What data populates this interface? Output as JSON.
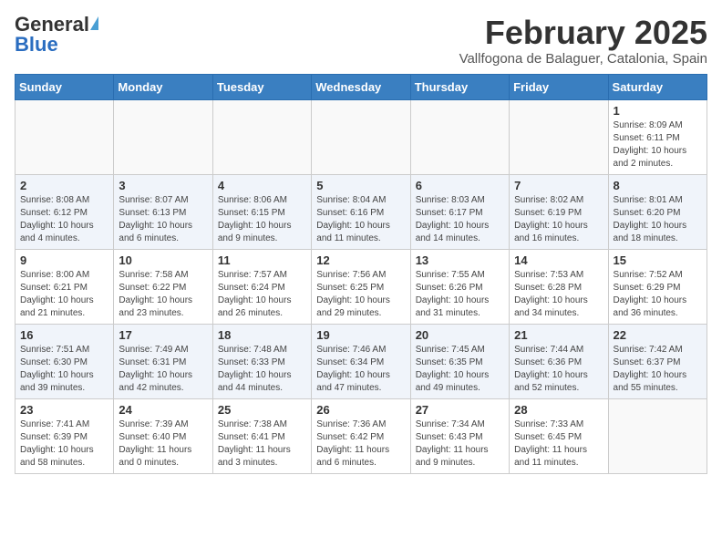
{
  "header": {
    "logo_general": "General",
    "logo_blue": "Blue",
    "month_title": "February 2025",
    "location": "Vallfogona de Balaguer, Catalonia, Spain"
  },
  "weekdays": [
    "Sunday",
    "Monday",
    "Tuesday",
    "Wednesday",
    "Thursday",
    "Friday",
    "Saturday"
  ],
  "weeks": [
    [
      {
        "day": "",
        "info": ""
      },
      {
        "day": "",
        "info": ""
      },
      {
        "day": "",
        "info": ""
      },
      {
        "day": "",
        "info": ""
      },
      {
        "day": "",
        "info": ""
      },
      {
        "day": "",
        "info": ""
      },
      {
        "day": "1",
        "info": "Sunrise: 8:09 AM\nSunset: 6:11 PM\nDaylight: 10 hours\nand 2 minutes."
      }
    ],
    [
      {
        "day": "2",
        "info": "Sunrise: 8:08 AM\nSunset: 6:12 PM\nDaylight: 10 hours\nand 4 minutes."
      },
      {
        "day": "3",
        "info": "Sunrise: 8:07 AM\nSunset: 6:13 PM\nDaylight: 10 hours\nand 6 minutes."
      },
      {
        "day": "4",
        "info": "Sunrise: 8:06 AM\nSunset: 6:15 PM\nDaylight: 10 hours\nand 9 minutes."
      },
      {
        "day": "5",
        "info": "Sunrise: 8:04 AM\nSunset: 6:16 PM\nDaylight: 10 hours\nand 11 minutes."
      },
      {
        "day": "6",
        "info": "Sunrise: 8:03 AM\nSunset: 6:17 PM\nDaylight: 10 hours\nand 14 minutes."
      },
      {
        "day": "7",
        "info": "Sunrise: 8:02 AM\nSunset: 6:19 PM\nDaylight: 10 hours\nand 16 minutes."
      },
      {
        "day": "8",
        "info": "Sunrise: 8:01 AM\nSunset: 6:20 PM\nDaylight: 10 hours\nand 18 minutes."
      }
    ],
    [
      {
        "day": "9",
        "info": "Sunrise: 8:00 AM\nSunset: 6:21 PM\nDaylight: 10 hours\nand 21 minutes."
      },
      {
        "day": "10",
        "info": "Sunrise: 7:58 AM\nSunset: 6:22 PM\nDaylight: 10 hours\nand 23 minutes."
      },
      {
        "day": "11",
        "info": "Sunrise: 7:57 AM\nSunset: 6:24 PM\nDaylight: 10 hours\nand 26 minutes."
      },
      {
        "day": "12",
        "info": "Sunrise: 7:56 AM\nSunset: 6:25 PM\nDaylight: 10 hours\nand 29 minutes."
      },
      {
        "day": "13",
        "info": "Sunrise: 7:55 AM\nSunset: 6:26 PM\nDaylight: 10 hours\nand 31 minutes."
      },
      {
        "day": "14",
        "info": "Sunrise: 7:53 AM\nSunset: 6:28 PM\nDaylight: 10 hours\nand 34 minutes."
      },
      {
        "day": "15",
        "info": "Sunrise: 7:52 AM\nSunset: 6:29 PM\nDaylight: 10 hours\nand 36 minutes."
      }
    ],
    [
      {
        "day": "16",
        "info": "Sunrise: 7:51 AM\nSunset: 6:30 PM\nDaylight: 10 hours\nand 39 minutes."
      },
      {
        "day": "17",
        "info": "Sunrise: 7:49 AM\nSunset: 6:31 PM\nDaylight: 10 hours\nand 42 minutes."
      },
      {
        "day": "18",
        "info": "Sunrise: 7:48 AM\nSunset: 6:33 PM\nDaylight: 10 hours\nand 44 minutes."
      },
      {
        "day": "19",
        "info": "Sunrise: 7:46 AM\nSunset: 6:34 PM\nDaylight: 10 hours\nand 47 minutes."
      },
      {
        "day": "20",
        "info": "Sunrise: 7:45 AM\nSunset: 6:35 PM\nDaylight: 10 hours\nand 49 minutes."
      },
      {
        "day": "21",
        "info": "Sunrise: 7:44 AM\nSunset: 6:36 PM\nDaylight: 10 hours\nand 52 minutes."
      },
      {
        "day": "22",
        "info": "Sunrise: 7:42 AM\nSunset: 6:37 PM\nDaylight: 10 hours\nand 55 minutes."
      }
    ],
    [
      {
        "day": "23",
        "info": "Sunrise: 7:41 AM\nSunset: 6:39 PM\nDaylight: 10 hours\nand 58 minutes."
      },
      {
        "day": "24",
        "info": "Sunrise: 7:39 AM\nSunset: 6:40 PM\nDaylight: 11 hours\nand 0 minutes."
      },
      {
        "day": "25",
        "info": "Sunrise: 7:38 AM\nSunset: 6:41 PM\nDaylight: 11 hours\nand 3 minutes."
      },
      {
        "day": "26",
        "info": "Sunrise: 7:36 AM\nSunset: 6:42 PM\nDaylight: 11 hours\nand 6 minutes."
      },
      {
        "day": "27",
        "info": "Sunrise: 7:34 AM\nSunset: 6:43 PM\nDaylight: 11 hours\nand 9 minutes."
      },
      {
        "day": "28",
        "info": "Sunrise: 7:33 AM\nSunset: 6:45 PM\nDaylight: 11 hours\nand 11 minutes."
      },
      {
        "day": "",
        "info": ""
      }
    ]
  ]
}
